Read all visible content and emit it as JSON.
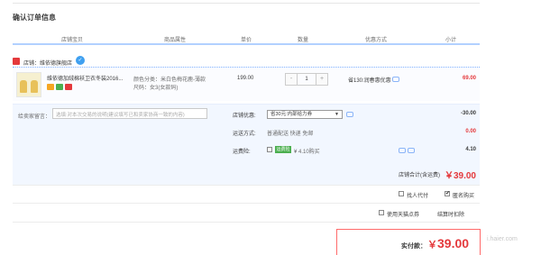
{
  "page_title": "确认订单信息",
  "columns": [
    "店铺宝贝",
    "商品属性",
    "单价",
    "数量",
    "优惠方式",
    "小计"
  ],
  "shop": {
    "label": "店铺：",
    "name": "维依德旗舰店",
    "wangwang_icon": "wangwang-chat-icon"
  },
  "item": {
    "title": "维依德加绒棉袄卫衣冬装2016...",
    "attr_color": "颜色分类：米白色梅花鹿-薄款",
    "attr_size": "尺码：女3(女款码)",
    "unit_price": "199.00",
    "qty": "1",
    "qty_minus": "-",
    "qty_plus": "+",
    "promo": "省130:润春惠优惠",
    "subtotal": "69.00",
    "badge_colors": [
      "#f5a623",
      "#4caf50",
      "#e4393c"
    ]
  },
  "options": {
    "message_label": "给卖家留言：",
    "message_placeholder": "选填:对本次交易的说明(建议填写已和卖家协商一致的内容)",
    "shop_promo_label": "店铺优惠:",
    "shop_promo_value": "省30元:内部给力券",
    "shop_promo_amount": "-30.00",
    "shipping_label": "运送方式:",
    "shipping_text": "普通配送 快递 免邮",
    "shipping_amount": "0.00",
    "insurance_label": "运费险:",
    "insurance_tag": "运费险",
    "insurance_price": "¥ 4.10购买",
    "insurance_amount": "4.10",
    "shop_total_label": "店铺合计(含运费)",
    "shop_total": "￥39.00"
  },
  "extras": {
    "proxy_pay": "找人代付",
    "anonymous": "匿名购买",
    "tmall_points": "使用天猫点券",
    "points_balance": "结算时扣除"
  },
  "payment": {
    "label": "实付款：",
    "currency": "￥",
    "amount": "39.00"
  },
  "watermark": "i.haier.com"
}
